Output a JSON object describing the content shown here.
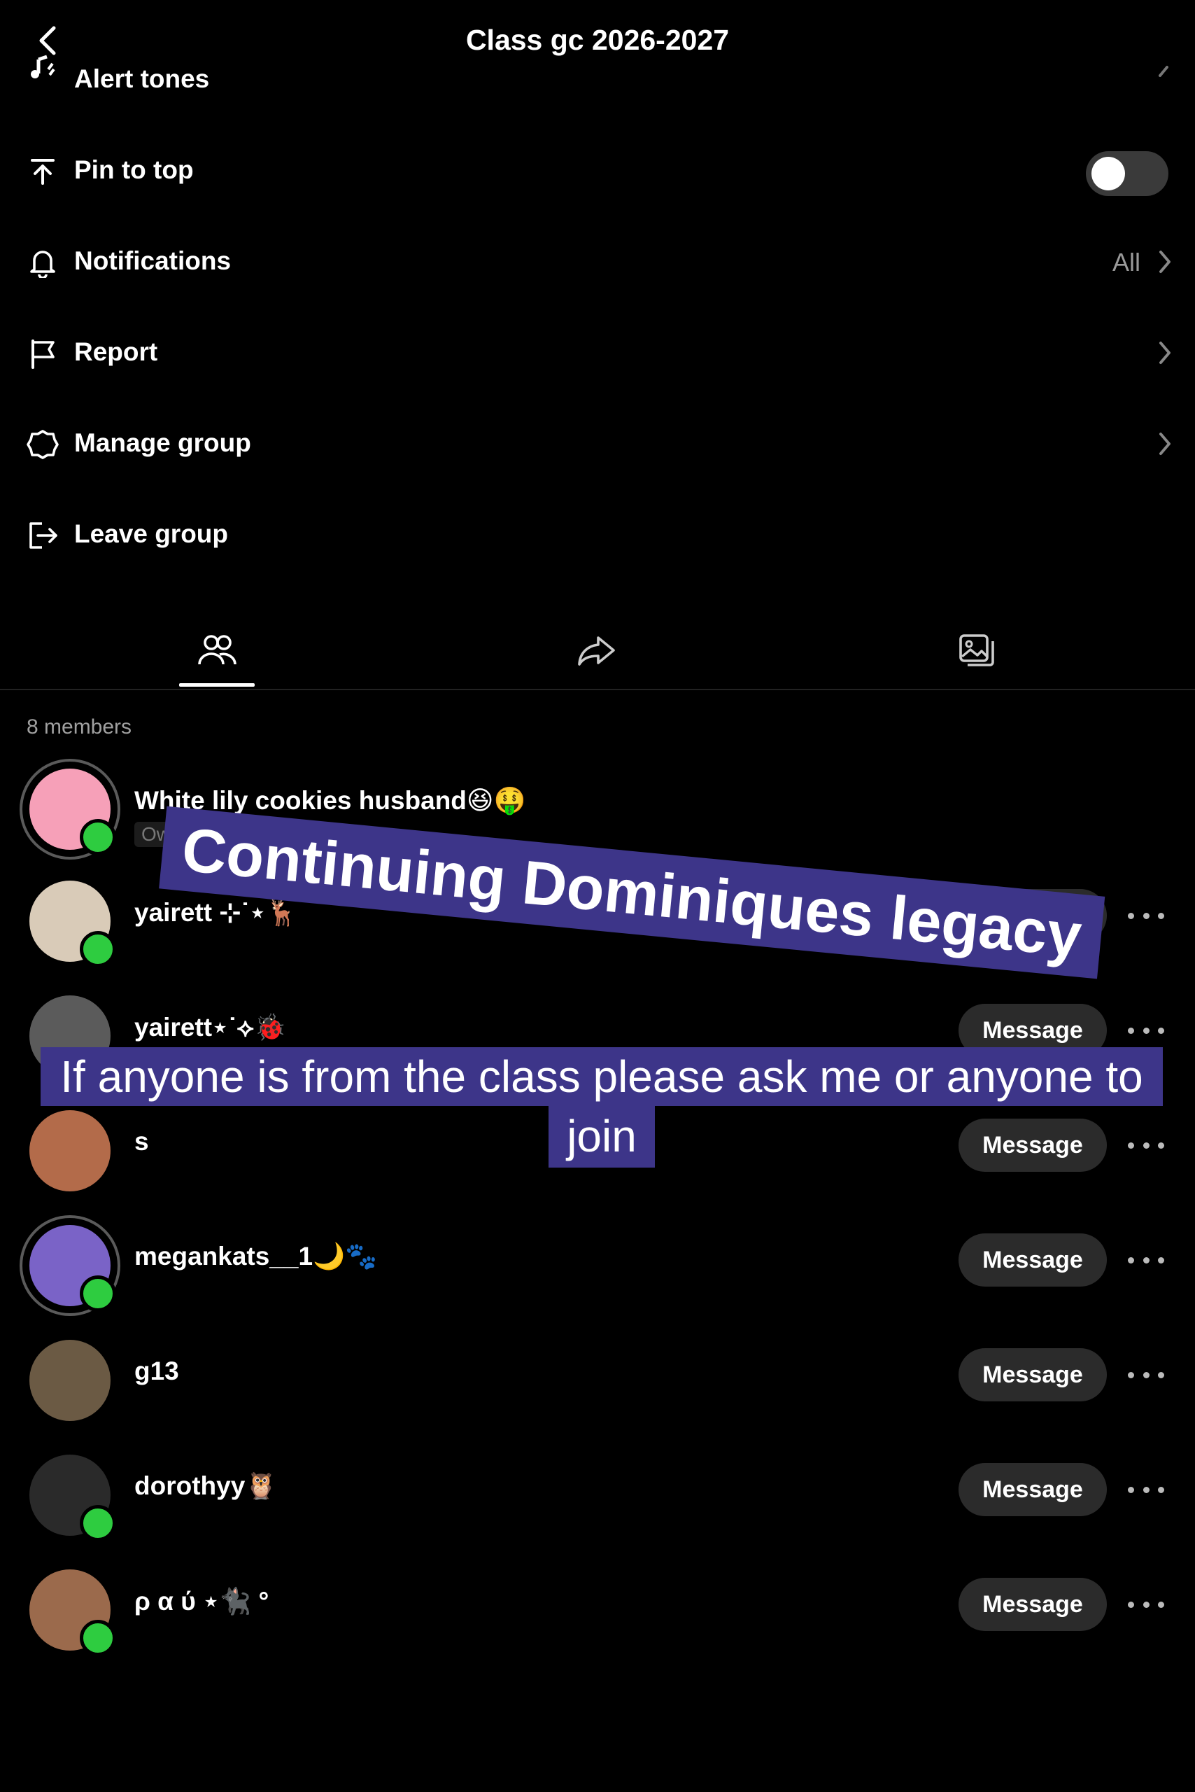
{
  "header": {
    "title": "Class gc 2026-2027"
  },
  "menu": [
    {
      "label": "Alert tones",
      "icon": "music-note-icon"
    },
    {
      "label": "Pin to top",
      "icon": "pin-top-icon",
      "toggle": false
    },
    {
      "label": "Notifications",
      "icon": "bell-icon",
      "value": "All"
    },
    {
      "label": "Report",
      "icon": "flag-icon"
    },
    {
      "label": "Manage group",
      "icon": "gear-icon"
    },
    {
      "label": "Leave group",
      "icon": "exit-icon"
    }
  ],
  "tabs": [
    "members-icon",
    "share-icon",
    "media-icon"
  ],
  "members_count": "8 members",
  "message_label": "Message",
  "members": [
    {
      "name": "White lily cookies husband😆🤑",
      "badge": "Owner",
      "online": true,
      "avatar_color": "#f6a0b8"
    },
    {
      "name": "yairett ⊹˙⋆🦌",
      "online": true,
      "avatar_color": "#d9cbb8"
    },
    {
      "name": "yairett⋆˙⟡🐞",
      "online": false,
      "avatar_color": "#5b5b5b"
    },
    {
      "name": "s",
      "online": false,
      "avatar_color": "#b36b4a"
    },
    {
      "name": "megankats__1🌙🐾",
      "online": true,
      "avatar_color": "#7a63c7"
    },
    {
      "name": "g13",
      "online": false,
      "avatar_color": "#6b5a44"
    },
    {
      "name": "dorothyy🦉",
      "online": true,
      "avatar_color": "#2a2a2a"
    },
    {
      "name": "ρ α ύ ⋆🐈‍⬛ °",
      "online": true,
      "avatar_color": "#9b6a4c"
    }
  ],
  "overlay": {
    "caption1": "Continuing Dominiques legacy",
    "caption2_line1": "If anyone is from the class please ask me or anyone to",
    "caption2_line2": "join"
  },
  "colors": {
    "overlay_bg": "#3d3589",
    "online_dot": "#2ecc40",
    "background": "#000000"
  }
}
